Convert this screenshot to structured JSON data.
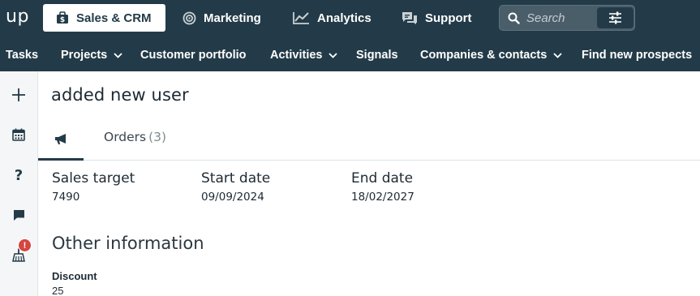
{
  "app": {
    "logo": "up"
  },
  "top_tabs": [
    {
      "label": "Sales & CRM",
      "icon": "briefcase-dollar-icon",
      "active": true
    },
    {
      "label": "Marketing",
      "icon": "target-icon",
      "active": false
    },
    {
      "label": "Analytics",
      "icon": "line-chart-icon",
      "active": false
    },
    {
      "label": "Support",
      "icon": "chat-bubbles-icon",
      "active": false
    }
  ],
  "search": {
    "placeholder": "Search",
    "icon": "search-icon",
    "filter_icon": "sliders-icon"
  },
  "nav": [
    {
      "label": "Tasks",
      "dropdown": false
    },
    {
      "label": "Projects",
      "dropdown": true
    },
    {
      "label": "Customer portfolio",
      "dropdown": false
    },
    {
      "label": "Activities",
      "dropdown": true
    },
    {
      "label": "Signals",
      "dropdown": false
    },
    {
      "label": "Companies & contacts",
      "dropdown": true
    },
    {
      "label": "Find new prospects",
      "dropdown": false
    }
  ],
  "sidebar": {
    "items": [
      {
        "icon": "plus-icon"
      },
      {
        "icon": "calendar-icon"
      },
      {
        "icon": "help-icon"
      },
      {
        "icon": "chat-icon"
      },
      {
        "icon": "broom-icon"
      }
    ],
    "badge": "!"
  },
  "main": {
    "title": "added new user",
    "tabs": {
      "icon_tab": "megaphone-icon",
      "orders_label": "Orders",
      "orders_count": "(3)"
    },
    "fields": [
      {
        "label": "Sales target",
        "value": "7490"
      },
      {
        "label": "Start date",
        "value": "09/09/2024"
      },
      {
        "label": "End date",
        "value": "18/02/2027"
      }
    ],
    "other_information": {
      "title": "Other information",
      "discount_label": "Discount",
      "discount_value": "25"
    }
  },
  "colors": {
    "header_bg": "#233b48",
    "badge": "#d64541",
    "sidebar_bg": "#f5f6f7"
  }
}
